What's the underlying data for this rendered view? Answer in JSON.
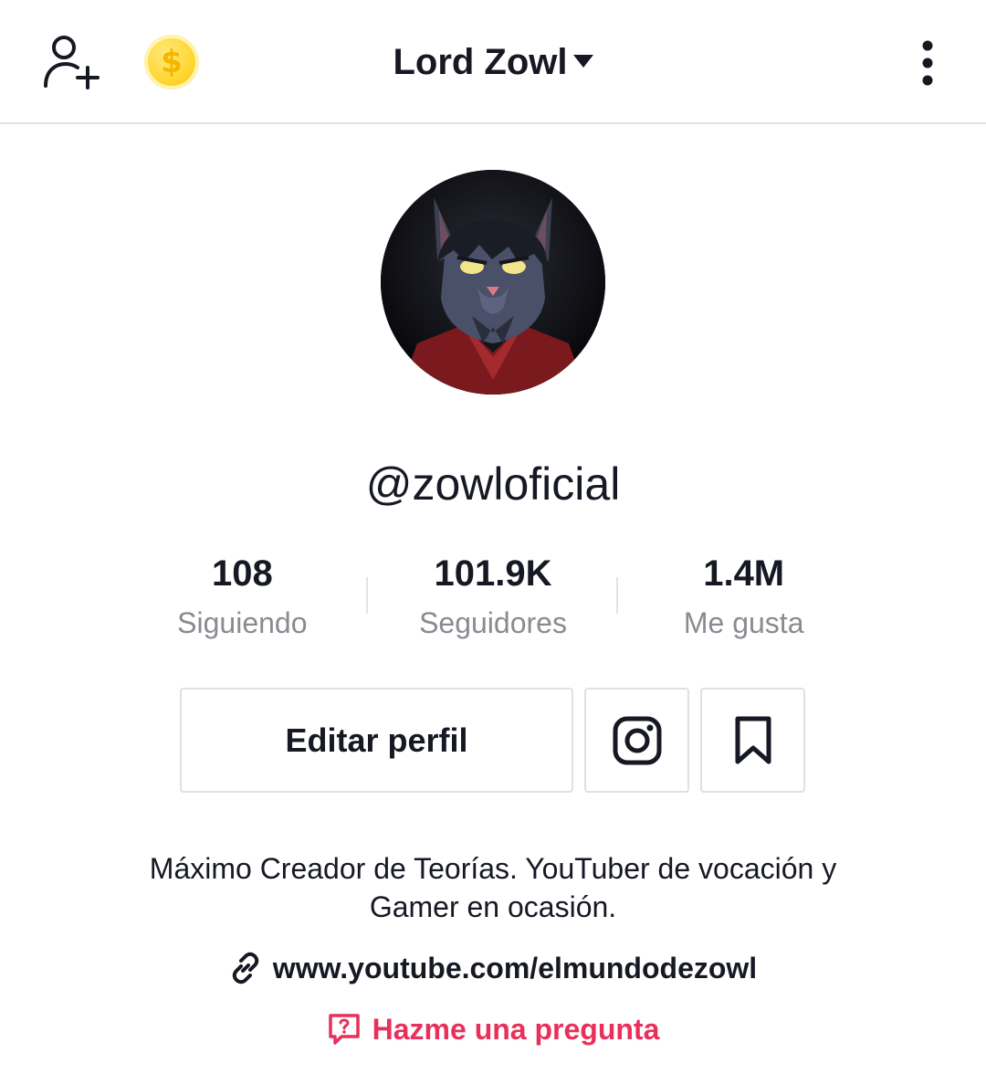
{
  "header": {
    "title": "Lord Zowl",
    "coin_symbol": "$",
    "icons": [
      "add-user-icon",
      "coin-icon",
      "chevron-down-icon",
      "more-vertical-icon"
    ]
  },
  "profile": {
    "handle": "@zowloficial",
    "avatar_icon": "avatar"
  },
  "stats": [
    {
      "value": "108",
      "label": "Siguiendo"
    },
    {
      "value": "101.9K",
      "label": "Seguidores"
    },
    {
      "value": "1.4M",
      "label": "Me gusta"
    }
  ],
  "actions": {
    "edit_label": "Editar perfil",
    "icons": [
      "instagram-icon",
      "bookmark-icon"
    ]
  },
  "bio": {
    "line1": "Máximo Creador de Teorías. YouTuber de vocación y",
    "line2": "Gamer en ocasión."
  },
  "link": {
    "url": "www.youtube.com/elmundodezowl",
    "icon": "link-icon"
  },
  "ask": {
    "label": "Hazme una pregunta",
    "icon": "question-box-icon"
  },
  "colors": {
    "text": "#161823",
    "muted": "#8a8b91",
    "accent": "#e8305a",
    "coin": "#ffd633",
    "border": "#e0e0e2"
  }
}
